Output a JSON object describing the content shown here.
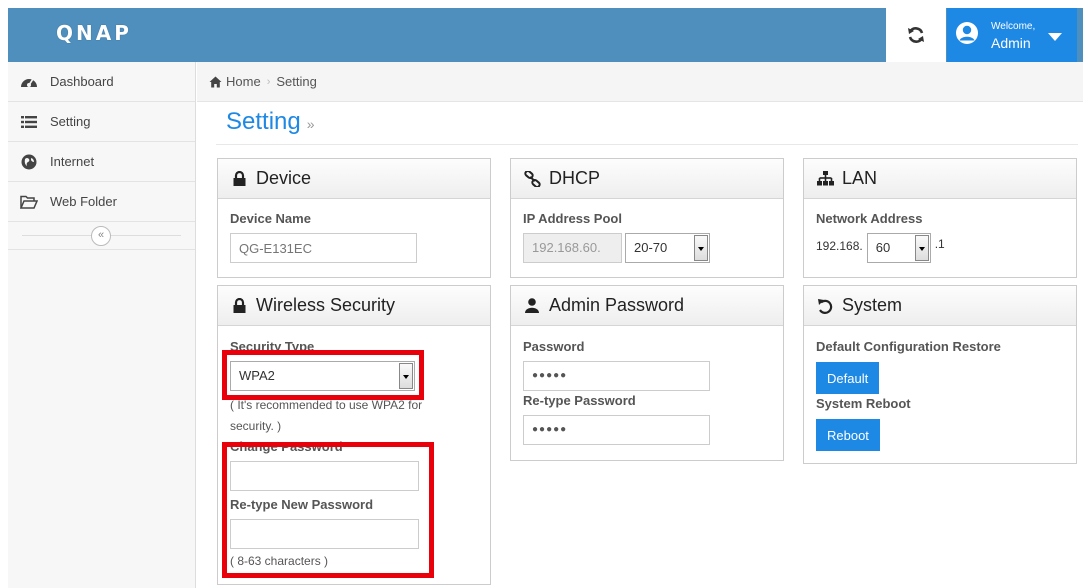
{
  "header": {
    "logo": "QNAP",
    "welcome": "Welcome,",
    "user": "Admin"
  },
  "sidebar": {
    "items": [
      {
        "label": "Dashboard",
        "icon": "dashboard-icon"
      },
      {
        "label": "Setting",
        "icon": "list-icon"
      },
      {
        "label": "Internet",
        "icon": "globe-icon"
      },
      {
        "label": "Web Folder",
        "icon": "folder-open-icon"
      }
    ],
    "collapse": "«"
  },
  "breadcrumb": {
    "home": "Home",
    "separator": "›",
    "current": "Setting"
  },
  "page": {
    "title": "Setting",
    "title_suffix": "»"
  },
  "device": {
    "title": "Device",
    "name_label": "Device Name",
    "name_placeholder": "QG-E131EC"
  },
  "dhcp": {
    "title": "DHCP",
    "pool_label": "IP Address Pool",
    "pool_prefix": "192.168.60.",
    "pool_range": "20-70"
  },
  "lan": {
    "title": "LAN",
    "address_label": "Network Address",
    "prefix": "192.168.",
    "octet": "60",
    "suffix": ".1"
  },
  "wireless": {
    "title": "Wireless Security",
    "type_label": "Security Type",
    "type_value": "WPA2",
    "recommend_note": "( It's recommended to use WPA2 for security. )",
    "change_label": "Change Password",
    "retype_label": "Re-type New Password",
    "length_note": "( 8-63 characters )"
  },
  "admin_password": {
    "title": "Admin Password",
    "password_label": "Password",
    "password_value": "●●●●●",
    "retype_label": "Re-type Password",
    "retype_value": "●●●●●"
  },
  "system": {
    "title": "System",
    "restore_label": "Default Configuration Restore",
    "default_button": "Default",
    "reboot_label": "System Reboot",
    "reboot_button": "Reboot"
  },
  "colors": {
    "header_bg": "#4f8fbe",
    "accent": "#1e88e5",
    "highlight": "#e8000b"
  }
}
